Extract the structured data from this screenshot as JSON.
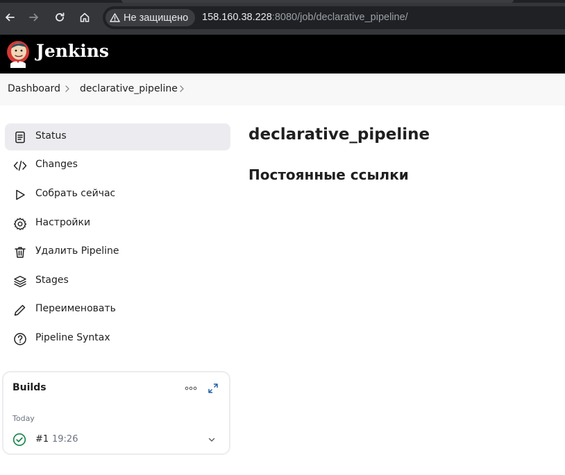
{
  "browser": {
    "security_label": "Не защищено",
    "url_host": "158.160.38.228",
    "url_rest": ":8080/job/declarative_pipeline/"
  },
  "header": {
    "app_title": "Jenkins"
  },
  "breadcrumb": {
    "items": [
      "Dashboard",
      "declarative_pipeline"
    ]
  },
  "sidebar": {
    "items": [
      {
        "label": "Status",
        "icon": "document-icon",
        "active": true
      },
      {
        "label": "Changes",
        "icon": "code-icon"
      },
      {
        "label": "Собрать сейчас",
        "icon": "play-icon"
      },
      {
        "label": "Настройки",
        "icon": "gear-icon"
      },
      {
        "label": "Удалить Pipeline",
        "icon": "trash-icon"
      },
      {
        "label": "Stages",
        "icon": "layers-icon"
      },
      {
        "label": "Переименовать",
        "icon": "pencil-icon"
      },
      {
        "label": "Pipeline Syntax",
        "icon": "help-icon"
      }
    ]
  },
  "main": {
    "title": "declarative_pipeline",
    "section_title": "Постоянные ссылки"
  },
  "builds": {
    "title": "Builds",
    "group_label": "Today",
    "items": [
      {
        "number": "#1",
        "time": "19:26",
        "status": "success"
      }
    ]
  },
  "colors": {
    "success": "#138347",
    "header_bg": "#000000",
    "active_bg": "#ececf0"
  }
}
